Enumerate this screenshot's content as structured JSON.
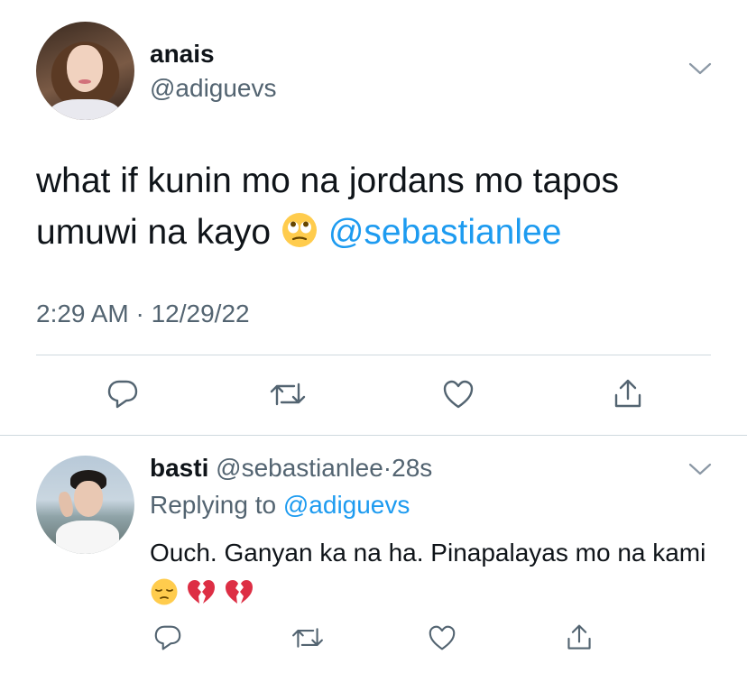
{
  "main_tweet": {
    "display_name": "anais",
    "handle": "@adiguevs",
    "text_before": "what if kunin mo na jordans mo tapos umuwi na kayo",
    "emoji": "rolling-eyes-emoji",
    "mention": "@sebastianlee",
    "timestamp": "2:29 AM · 12/29/22",
    "actions": [
      "reply-icon",
      "retweet-icon",
      "like-icon",
      "share-icon"
    ]
  },
  "reply_tweet": {
    "display_name": "basti",
    "handle": "@sebastianlee",
    "separator": "·",
    "time_ago": "28s",
    "replying_to_label": "Replying to",
    "replying_to_handle": "@adiguevs",
    "text": "Ouch. Ganyan ka na ha. Pinapalayas mo na kami",
    "emojis": [
      "pensive-face-emoji",
      "broken-heart-emoji",
      "broken-heart-emoji"
    ],
    "actions": [
      "reply-icon",
      "retweet-icon",
      "like-icon",
      "share-icon"
    ]
  },
  "colors": {
    "text": "#0f1419",
    "secondary": "#536471",
    "mention": "#1d9bf0",
    "divider": "#cfd9de",
    "icon": "#536471"
  }
}
